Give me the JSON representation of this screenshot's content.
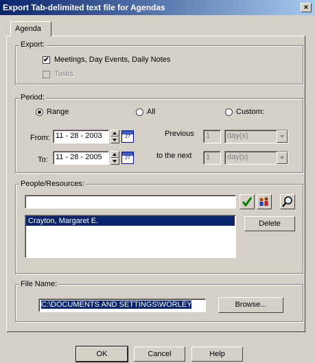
{
  "window": {
    "title": "Export Tab-delimited text file for Agendas",
    "close_glyph": "×"
  },
  "tabs": [
    {
      "label": "Agenda",
      "selected": true
    }
  ],
  "export_group": {
    "label": "Export:",
    "options": [
      {
        "label": "Meetings, Day Events, Daily Notes",
        "checked": true,
        "enabled": true
      },
      {
        "label": "Tasks",
        "checked": false,
        "enabled": false
      }
    ]
  },
  "period_group": {
    "label": "Period:",
    "radios": [
      {
        "label": "Range",
        "selected": true
      },
      {
        "label": "All",
        "selected": false
      },
      {
        "label": "Custom:",
        "selected": false
      }
    ],
    "from_label": "From:",
    "from_value": "11 - 28 - 2003",
    "to_label": "To:",
    "to_value": "11 - 28 - 2005",
    "previous_label": "Previous",
    "previous_value": "1",
    "previous_unit": "day(s)",
    "next_label": "to the next",
    "next_value": "1",
    "next_unit": "day(s)",
    "calendar_icon_text": "27"
  },
  "people_group": {
    "label": "People/Resources:",
    "search_value": "",
    "list_items": [
      {
        "label": "Crayton, Margaret E.",
        "selected": true
      }
    ],
    "delete_label": "Delete",
    "icons": [
      "checkmark-icon",
      "people-icon",
      "magnifier-icon"
    ]
  },
  "file_group": {
    "label": "File Name:",
    "path_value": "C:\\DOCUMENTS AND SETTINGS\\WORLEY",
    "browse_label": "Browse..."
  },
  "footer": {
    "ok_label": "OK",
    "cancel_label": "Cancel",
    "help_label": "Help"
  },
  "colors": {
    "titlebar_start": "#0a246a",
    "titlebar_end": "#a6caf0",
    "face": "#d4d0c8",
    "selection": "#0a246a"
  }
}
